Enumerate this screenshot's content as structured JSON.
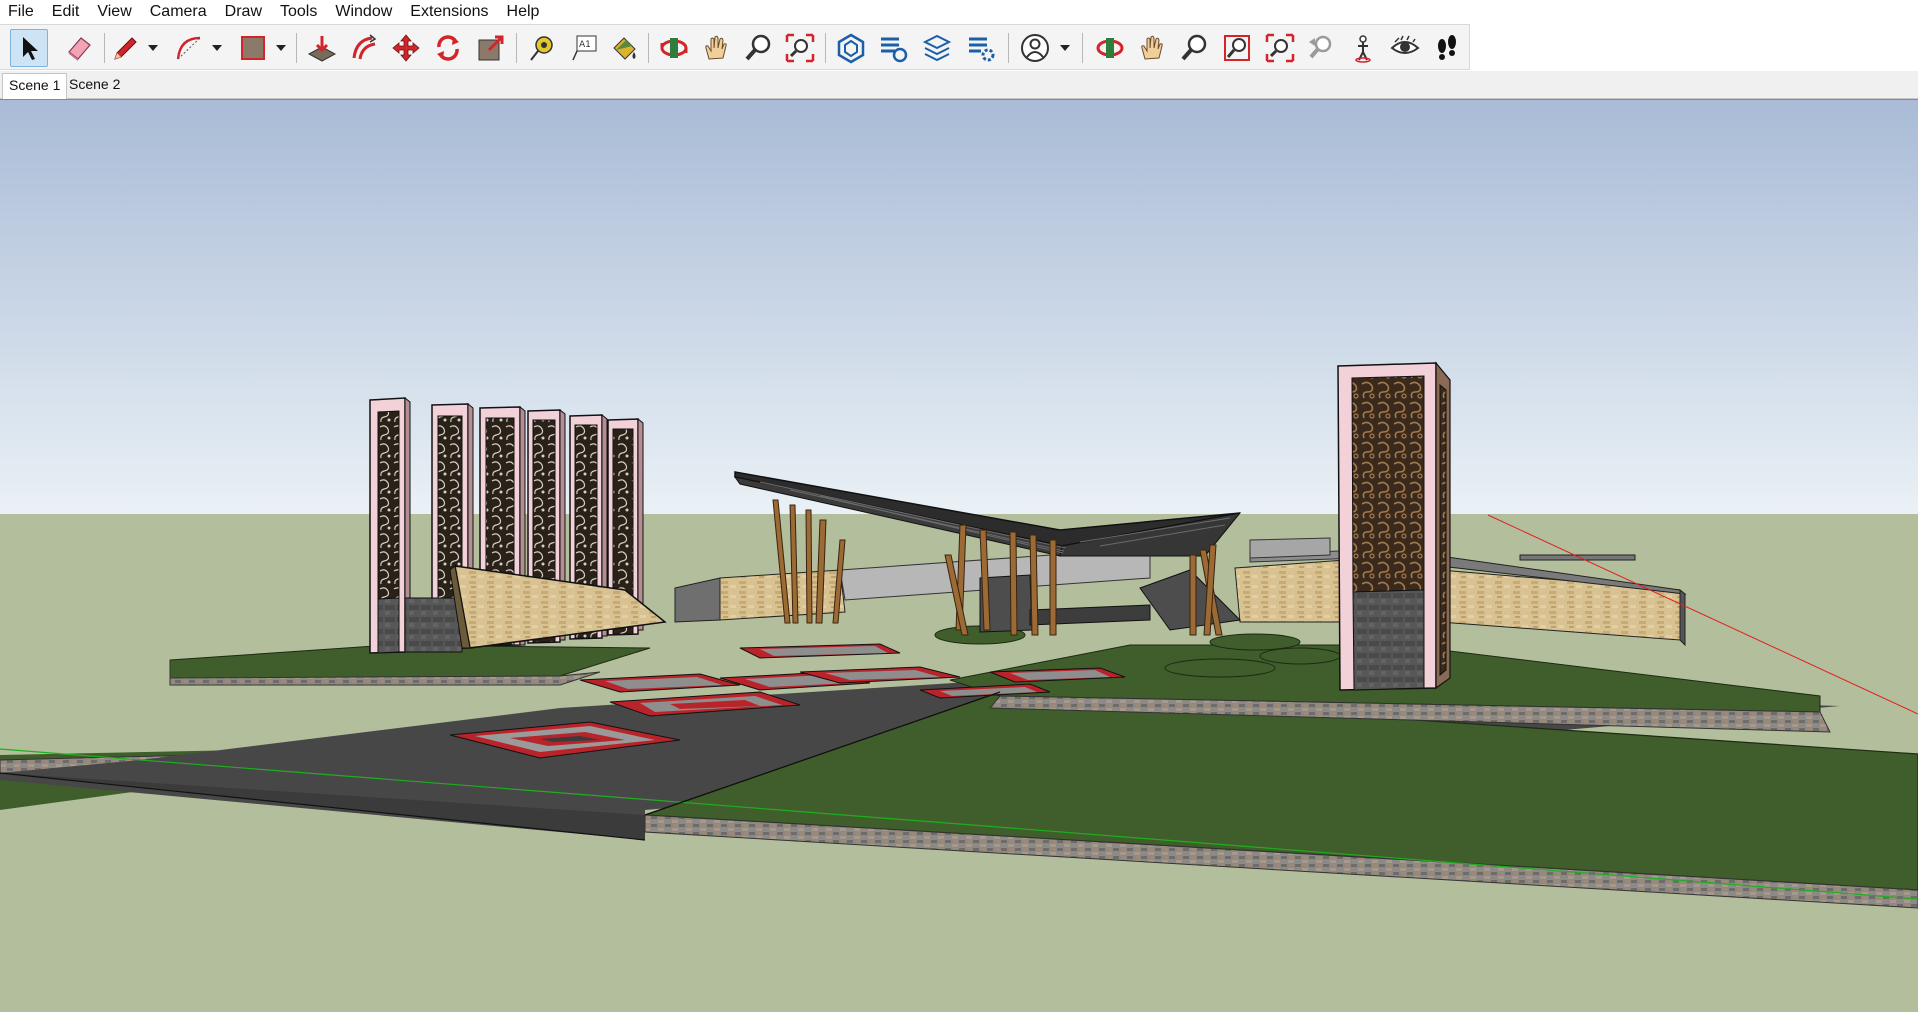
{
  "menu": [
    "File",
    "Edit",
    "View",
    "Camera",
    "Draw",
    "Tools",
    "Window",
    "Extensions",
    "Help"
  ],
  "toolbar": {
    "tools": [
      {
        "name": "select-tool-icon",
        "label": "Select",
        "active": true
      },
      {
        "name": "eraser-tool-icon",
        "label": "Eraser"
      },
      {
        "name": "pencil-tool-icon",
        "label": "Line"
      },
      {
        "name": "arc-tool-icon",
        "label": "Arc"
      },
      {
        "name": "rectangle-tool-icon",
        "label": "Rectangle"
      },
      {
        "name": "push-pull-tool-icon",
        "label": "Push/Pull"
      },
      {
        "name": "offset-tool-icon",
        "label": "Offset"
      },
      {
        "name": "move-tool-icon",
        "label": "Move"
      },
      {
        "name": "rotate-tool-icon",
        "label": "Rotate"
      },
      {
        "name": "scale-tool-icon",
        "label": "Scale"
      },
      {
        "name": "tape-measure-icon",
        "label": "Tape Measure"
      },
      {
        "name": "text-tool-icon",
        "label": "Text"
      },
      {
        "name": "paint-bucket-icon",
        "label": "Paint Bucket"
      },
      {
        "name": "orbit-icon",
        "label": "Orbit"
      },
      {
        "name": "pan-icon",
        "label": "Pan"
      },
      {
        "name": "zoom-icon",
        "label": "Zoom"
      },
      {
        "name": "zoom-extents-icon",
        "label": "Zoom Extents"
      },
      {
        "name": "warehouse-icon",
        "label": "3D Warehouse"
      },
      {
        "name": "extension-warehouse-icon",
        "label": "Extension Warehouse"
      },
      {
        "name": "layout-send-icon",
        "label": "Send to LayOut"
      },
      {
        "name": "extension-manager-icon",
        "label": "Extension Manager"
      },
      {
        "name": "account-icon",
        "label": "Account"
      },
      {
        "name": "orbit-icon-2",
        "label": "Orbit"
      },
      {
        "name": "pan-icon-2",
        "label": "Pan"
      },
      {
        "name": "zoom-icon-2",
        "label": "Zoom"
      },
      {
        "name": "zoom-window-icon",
        "label": "Zoom Window"
      },
      {
        "name": "zoom-extents-icon-2",
        "label": "Zoom Extents"
      },
      {
        "name": "previous-view-icon",
        "label": "Previous"
      },
      {
        "name": "position-camera-icon",
        "label": "Position Camera"
      },
      {
        "name": "look-around-icon",
        "label": "Look Around"
      },
      {
        "name": "walk-icon",
        "label": "Walk"
      }
    ]
  },
  "scenes": [
    {
      "label": "Scene 1",
      "selected": true
    },
    {
      "label": "Scene 2",
      "selected": false
    }
  ],
  "colors": {
    "sky_top": "#a9bbd6",
    "sky_bottom": "#e9f0f6",
    "ground": "#b3bf9c",
    "grass": "#3f5e2b",
    "paving": "#4b4b4b",
    "tile_red": "#b9242a",
    "wood": "#8a5a2a",
    "stone": "#cdb583",
    "axis_red": "#e02020",
    "axis_green": "#1fae1f"
  }
}
